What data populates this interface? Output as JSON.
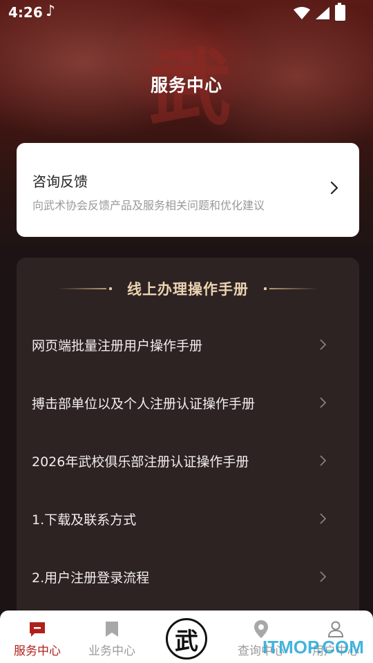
{
  "status_bar": {
    "time": "4:26"
  },
  "header": {
    "title": "服务中心",
    "bg_character": "武"
  },
  "feedback": {
    "title": "咨询反馈",
    "description": "向武术协会反馈产品及服务相关问题和优化建议"
  },
  "manuals": {
    "section_title": "线上办理操作手册",
    "items": [
      {
        "label": "网页端批量注册用户操作手册"
      },
      {
        "label": "搏击部单位以及个人注册认证操作手册"
      },
      {
        "label": "2026年武校俱乐部注册认证操作手册"
      },
      {
        "label": "1.下载及联系方式"
      },
      {
        "label": "2.用户注册登录流程"
      }
    ]
  },
  "tab_bar": {
    "tabs": [
      {
        "label": "服务中心",
        "icon": "message-icon",
        "active": true
      },
      {
        "label": "业务中心",
        "icon": "bookmark-icon",
        "active": false
      },
      {
        "label": "查询中心",
        "icon": "location-pin-icon",
        "active": false
      },
      {
        "label": "用户中心",
        "icon": "user-icon",
        "active": false
      }
    ],
    "center_logo_char": "武"
  },
  "watermark": "ITMOP.COM",
  "colors": {
    "accent": "#b0201a",
    "panel": "#2e2323",
    "gold": "#ecd4b2"
  }
}
